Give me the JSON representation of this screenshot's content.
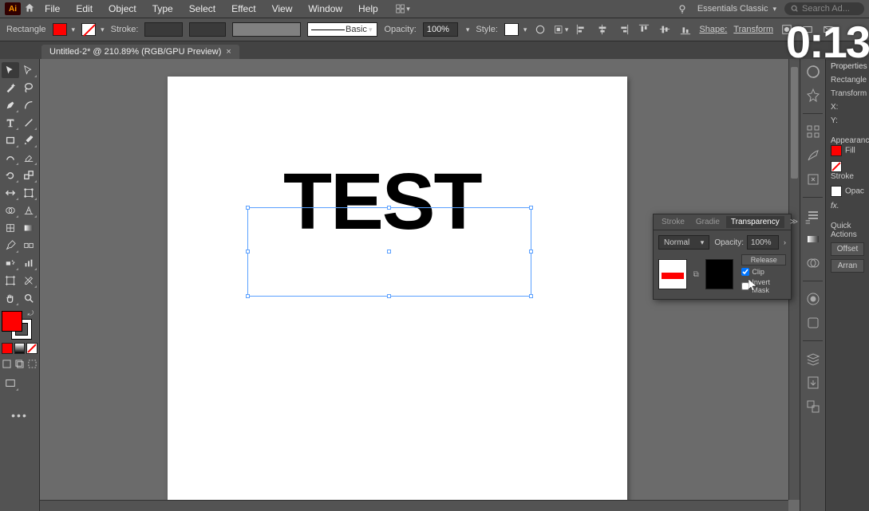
{
  "app": {
    "name": "Ai",
    "workspace": "Essentials Classic",
    "search_placeholder": "Search Ad..."
  },
  "menu": [
    "File",
    "Edit",
    "Object",
    "Type",
    "Select",
    "Effect",
    "View",
    "Window",
    "Help"
  ],
  "controlbar": {
    "shape": "Rectangle",
    "stroke_label": "Stroke:",
    "basic": "Basic",
    "opacity_label": "Opacity:",
    "opacity_value": "100%",
    "style_label": "Style:",
    "shape_label": "Shape:",
    "transform_label": "Transform"
  },
  "document_tab": {
    "title": "Untitled-2* @ 210.89% (RGB/GPU Preview)"
  },
  "canvas": {
    "text": "TEST"
  },
  "transparency_panel": {
    "tabs": [
      "Stroke",
      "Gradie",
      "Transparency"
    ],
    "active_tab": "Transparency",
    "blend_mode": "Normal",
    "opacity_label": "Opacity:",
    "opacity_value": "100%",
    "release": "Release",
    "clip": "Clip",
    "invert": "Invert Mask"
  },
  "properties": {
    "header": "Properties",
    "shape": "Rectangle",
    "transform": "Transform",
    "x": "X:",
    "y": "Y:",
    "appearance": "Appearance",
    "fill": "Fill",
    "stroke": "Stroke",
    "opacity": "Opac",
    "fx": "fx.",
    "quick_actions": "Quick Actions",
    "offset": "Offset",
    "arrange": "Arran"
  },
  "timer": "0:13"
}
